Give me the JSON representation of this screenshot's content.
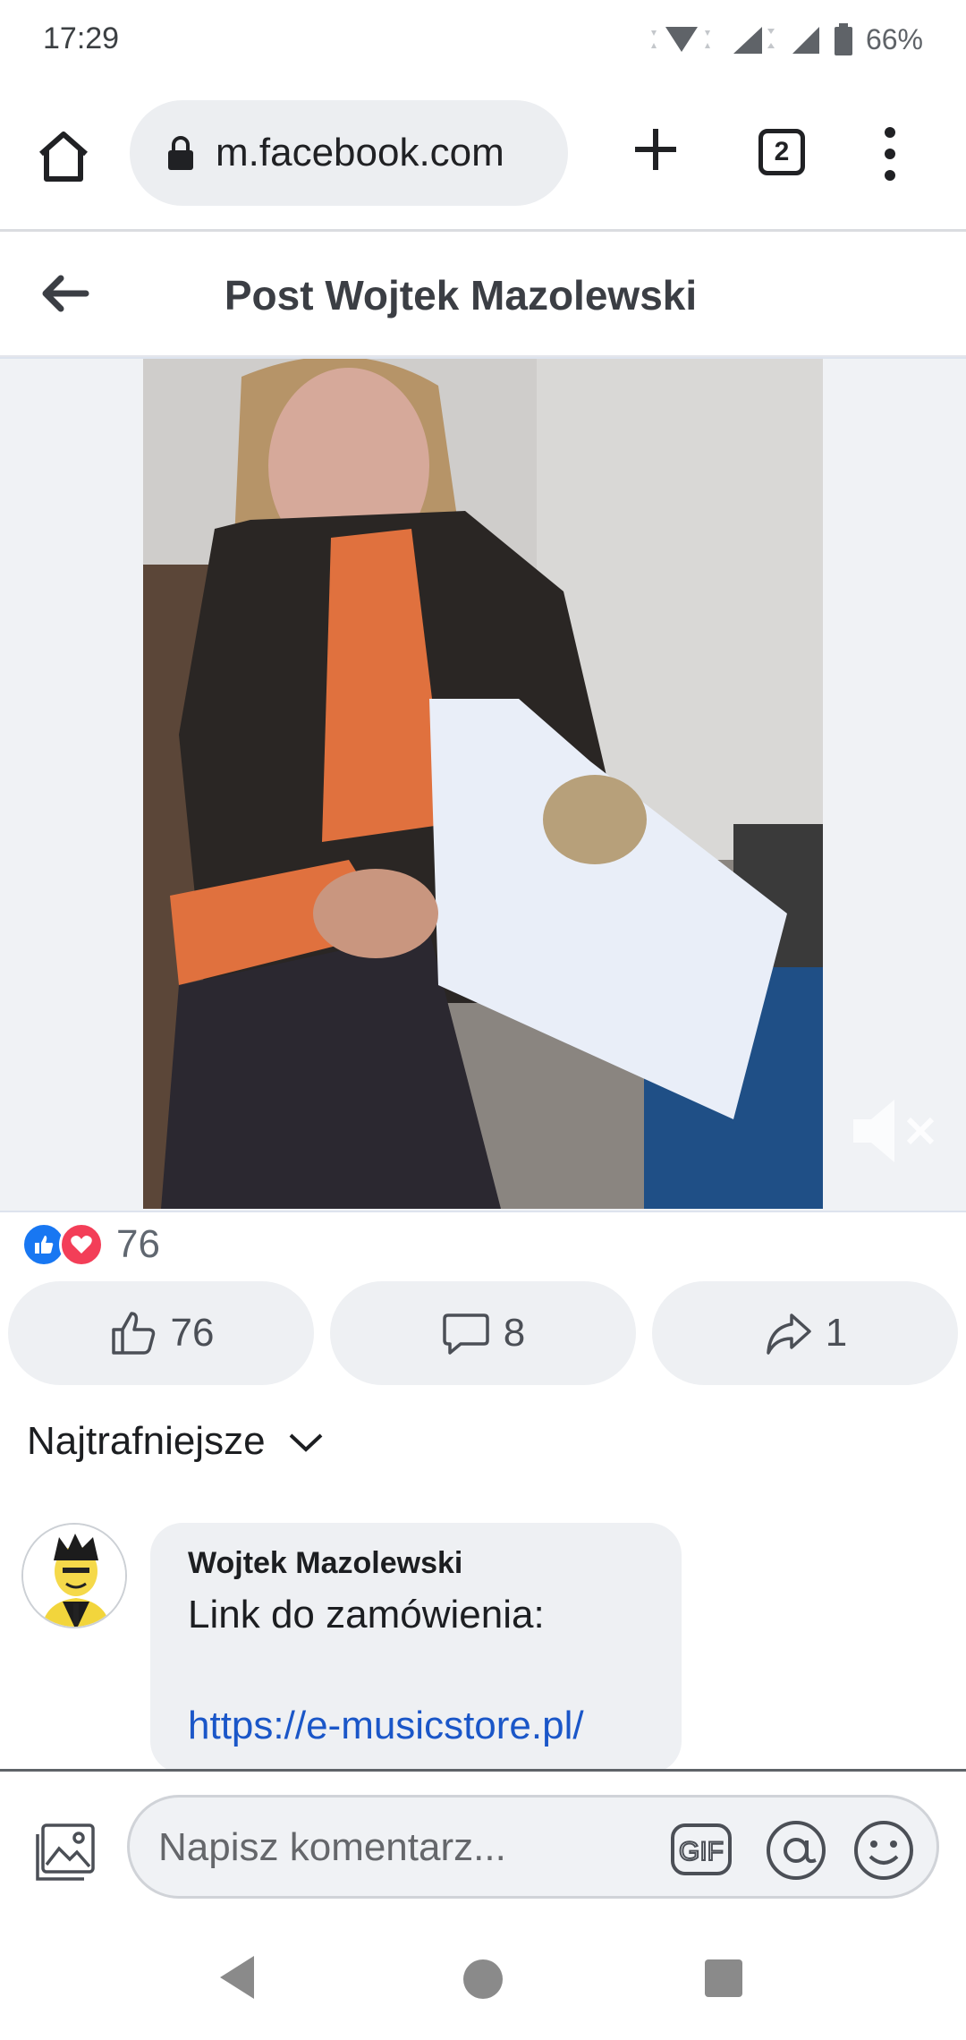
{
  "status_bar": {
    "time": "17:29",
    "battery": "66%"
  },
  "browser": {
    "url": "m.facebook.com",
    "tab_count": "2"
  },
  "header": {
    "title": "Post Wojtek Mazolewski"
  },
  "post": {
    "reaction_count": "76",
    "likes": "76",
    "comments": "8",
    "shares": "1"
  },
  "sort": {
    "label": "Najtrafniejsze"
  },
  "comment": {
    "author": "Wojtek Mazolewski",
    "text": "Link do zamówienia:",
    "link": "https://e-musicstore.pl/"
  },
  "composer": {
    "placeholder": "Napisz komentarz..."
  },
  "colors": {
    "facebook_blue": "#1877f2",
    "love_red": "#f33e58",
    "link_blue": "#1a56c8"
  }
}
